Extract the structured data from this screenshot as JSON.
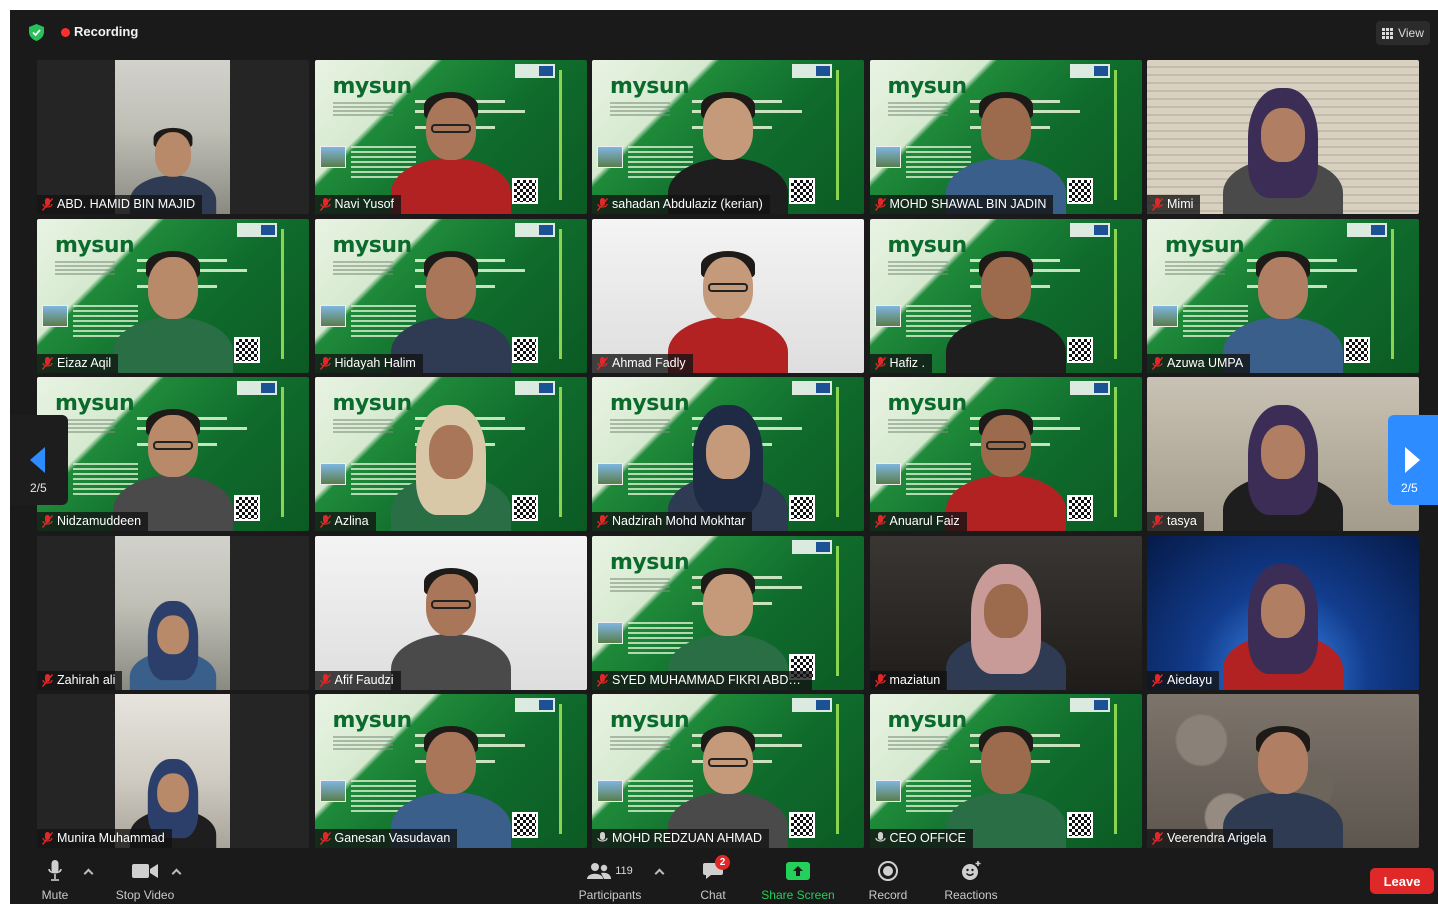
{
  "top_bar": {
    "recording_label": "Recording",
    "view_label": "View"
  },
  "participants": [
    {
      "name": "ABD. HAMID BIN MAJID",
      "muted": true,
      "background": "car"
    },
    {
      "name": "Navi Yusof",
      "muted": true,
      "background": "mysun-slide"
    },
    {
      "name": "sahadan Abdulaziz (kerian)",
      "muted": true,
      "background": "mysun-slide"
    },
    {
      "name": "MOHD SHAWAL BIN JADIN",
      "muted": true,
      "background": "mysun-slide"
    },
    {
      "name": "Mimi",
      "muted": true,
      "background": "blinds"
    },
    {
      "name": "Eizaz Aqil",
      "muted": true,
      "background": "mysun-slide"
    },
    {
      "name": "Hidayah Halim",
      "muted": true,
      "background": "mysun-slide"
    },
    {
      "name": "Ahmad Fadly",
      "muted": true,
      "background": "white"
    },
    {
      "name": "Hafiz .",
      "muted": true,
      "background": "mysun-slide"
    },
    {
      "name": "Azuwa UMPA",
      "muted": true,
      "background": "mysun-slide"
    },
    {
      "name": "Nidzamuddeen",
      "muted": true,
      "background": "mysun-slide"
    },
    {
      "name": "Azlina",
      "muted": true,
      "background": "mysun-slide"
    },
    {
      "name": "Nadzirah Mohd Mokhtar",
      "muted": true,
      "background": "mysun-slide"
    },
    {
      "name": "Anuarul Faiz",
      "muted": true,
      "background": "mysun-slide"
    },
    {
      "name": "tasya",
      "muted": true,
      "background": "home"
    },
    {
      "name": "Zahirah ali",
      "muted": true,
      "background": "car"
    },
    {
      "name": "Afif Faudzi",
      "muted": true,
      "background": "white"
    },
    {
      "name": "SYED MUHAMMAD FIKRI ABDU...",
      "muted": true,
      "background": "mysun-slide"
    },
    {
      "name": "maziatun",
      "muted": true,
      "background": "dark-room"
    },
    {
      "name": "Aiedayu",
      "muted": true,
      "background": "blue"
    },
    {
      "name": "Munira Muhammad",
      "muted": true,
      "background": "room"
    },
    {
      "name": "Ganesan Vasudavan",
      "muted": true,
      "background": "mysun-slide"
    },
    {
      "name": "MOHD REDZUAN AHMAD",
      "muted": false,
      "background": "mysun-slide"
    },
    {
      "name": "CEO OFFICE",
      "muted": false,
      "background": "mysun-slide"
    },
    {
      "name": "Veerendra Arigela",
      "muted": true,
      "background": "stone"
    }
  ],
  "slide_logo_text": "mysun",
  "pagination": {
    "left_page": "2/5",
    "right_page": "2/5"
  },
  "toolbar": {
    "mute_label": "Mute",
    "stop_video_label": "Stop Video",
    "participants_label": "Participants",
    "participants_count": "119",
    "chat_label": "Chat",
    "chat_badge": "2",
    "share_screen_label": "Share Screen",
    "record_label": "Record",
    "reactions_label": "Reactions",
    "leave_label": "Leave"
  },
  "colors": {
    "accent_blue": "#2d8cff",
    "recording_red": "#ff2f2f",
    "share_green": "#23d05a",
    "leave_red": "#e02828",
    "mic_off_red": "#e02828"
  }
}
